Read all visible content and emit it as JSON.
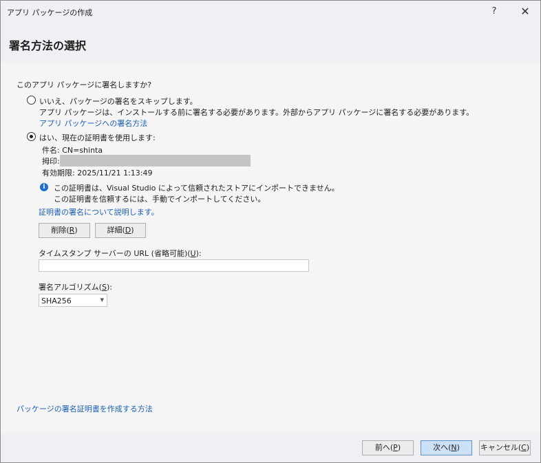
{
  "window": {
    "title": "アプリ パッケージの作成",
    "help_label": "?",
    "close_label": "✕"
  },
  "header": {
    "title": "署名方法の選択"
  },
  "main": {
    "question": "このアプリ パッケージに署名しますか?",
    "option_skip": {
      "label": "いいえ、パッケージの署名をスキップします。",
      "description": "アプリ パッケージは、インストールする前に署名する必要があります。外部からアプリ パッケージに署名する必要があります。",
      "link": "アプリ パッケージへの署名方法",
      "selected": false
    },
    "option_current": {
      "label": "はい、現在の証明書を使用します:",
      "selected": true
    },
    "cert": {
      "subject": "件名: CN=shinta",
      "thumbprint_label": "拇印:",
      "expiry": "有効期限: 2025/11/21 1:13:49"
    },
    "info": {
      "line1": "この証明書は、Visual Studio によって信頼されたストアにインポートできません。",
      "line2": "この証明書を信頼するには、手動でインポートしてください。"
    },
    "learn_link": "証明書の署名について説明します。",
    "delete_button": {
      "text": "削除(",
      "key": "R",
      "close": ")"
    },
    "details_button": {
      "text": "詳細(",
      "key": "D",
      "close": ")"
    },
    "timestamp": {
      "label_text": "タイムスタンプ サーバーの URL (省略可能)(",
      "label_key": "U",
      "label_close": "):",
      "value": ""
    },
    "algorithm": {
      "label_text": "署名アルゴリズム(",
      "label_key": "S",
      "label_close": "):",
      "value": "SHA256"
    },
    "howto_link": "パッケージの署名証明書を作成する方法"
  },
  "footer": {
    "prev": {
      "text": "前へ(",
      "key": "P",
      "close": ")"
    },
    "next": {
      "text": "次へ(",
      "key": "N",
      "close": ")"
    },
    "cancel": {
      "text": "キャンセル(",
      "key": "C",
      "close": ")"
    }
  }
}
